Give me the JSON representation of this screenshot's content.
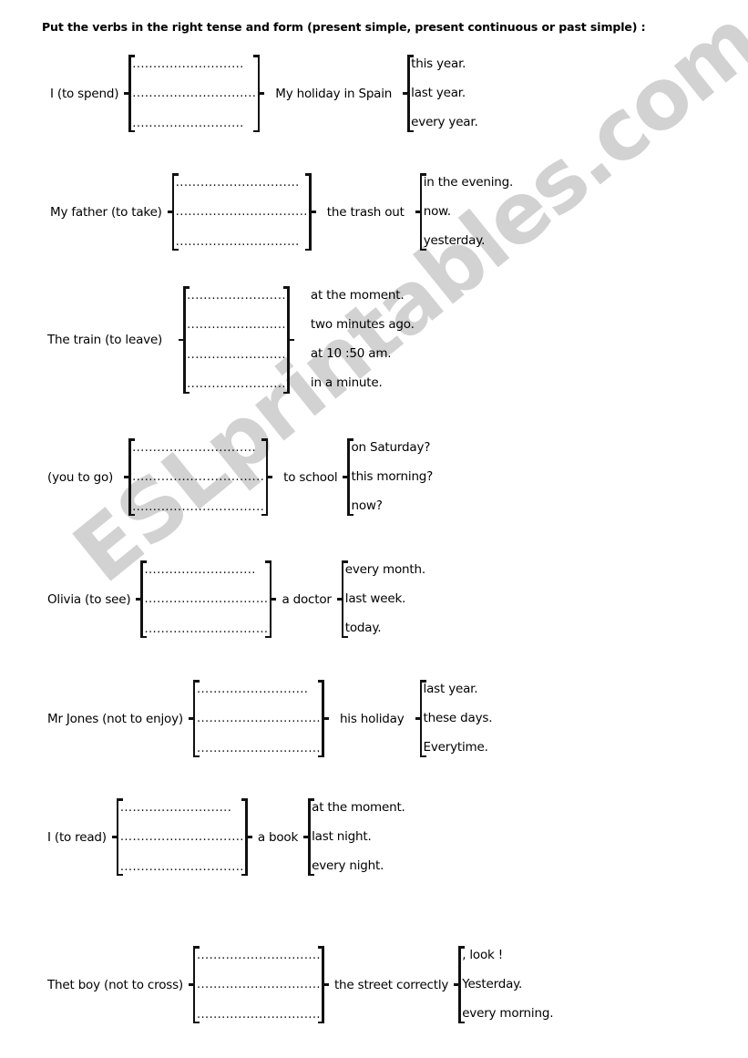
{
  "worksheet": {
    "title": "Put the verbs in the right tense and form (present simple, present continuous or past simple) :",
    "watermark": "ESLprintables.com",
    "blank_line": "..............................",
    "blank_line_short": "...........................",
    "blank_line_long": "................................"
  },
  "exercises": [
    {
      "id": "to-spend",
      "subject": "I (to spend)",
      "middle": "My holiday in Spain",
      "blanks": [
        "...........................",
        "..............................",
        "..........................."
      ],
      "options": [
        "this year.",
        "last year.",
        "every year."
      ]
    },
    {
      "id": "to-take",
      "subject": "My father (to take)",
      "middle": "the trash out",
      "blanks": [
        "..............................",
        "................................",
        ".............................."
      ],
      "options": [
        "in the evening.",
        "now.",
        "yesterday."
      ]
    },
    {
      "id": "to-leave",
      "subject": "The train (to leave)",
      "middle": "",
      "blanks": [
        "........................",
        "........................",
        "........................",
        "........................"
      ],
      "options": [
        "at the moment.",
        "two minutes ago.",
        "at 10 :50 am.",
        "in a minute."
      ]
    },
    {
      "id": "to-go",
      "subject": "(you to go)",
      "middle": "to school",
      "blanks": [
        "..............................",
        "................................",
        "................................"
      ],
      "options": [
        "on Saturday?",
        "this morning?",
        "now?"
      ]
    },
    {
      "id": "to-see",
      "subject": "Olivia (to see)",
      "middle": "a doctor",
      "blanks": [
        "...........................",
        "..............................",
        ".............................."
      ],
      "options": [
        "every month.",
        "last week.",
        "today."
      ]
    },
    {
      "id": "not-to-enjoy",
      "subject": "Mr Jones (not to enjoy)",
      "middle": "his holiday",
      "blanks": [
        "...........................",
        "..............................",
        ".............................."
      ],
      "options": [
        "last year.",
        "these days.",
        "Everytime."
      ]
    },
    {
      "id": "to-read",
      "subject": "I (to read)",
      "middle": "a book",
      "blanks": [
        "...........................",
        "..............................",
        ".............................."
      ],
      "options": [
        "at the moment.",
        "last night.",
        "every night."
      ]
    },
    {
      "id": "not-to-cross",
      "subject": "Thet boy (not to cross)",
      "middle": "the street correctly",
      "blanks": [
        "..............................",
        "..............................",
        ".............................."
      ],
      "options": [
        ", look !",
        "Yesterday.",
        "every morning."
      ]
    }
  ]
}
